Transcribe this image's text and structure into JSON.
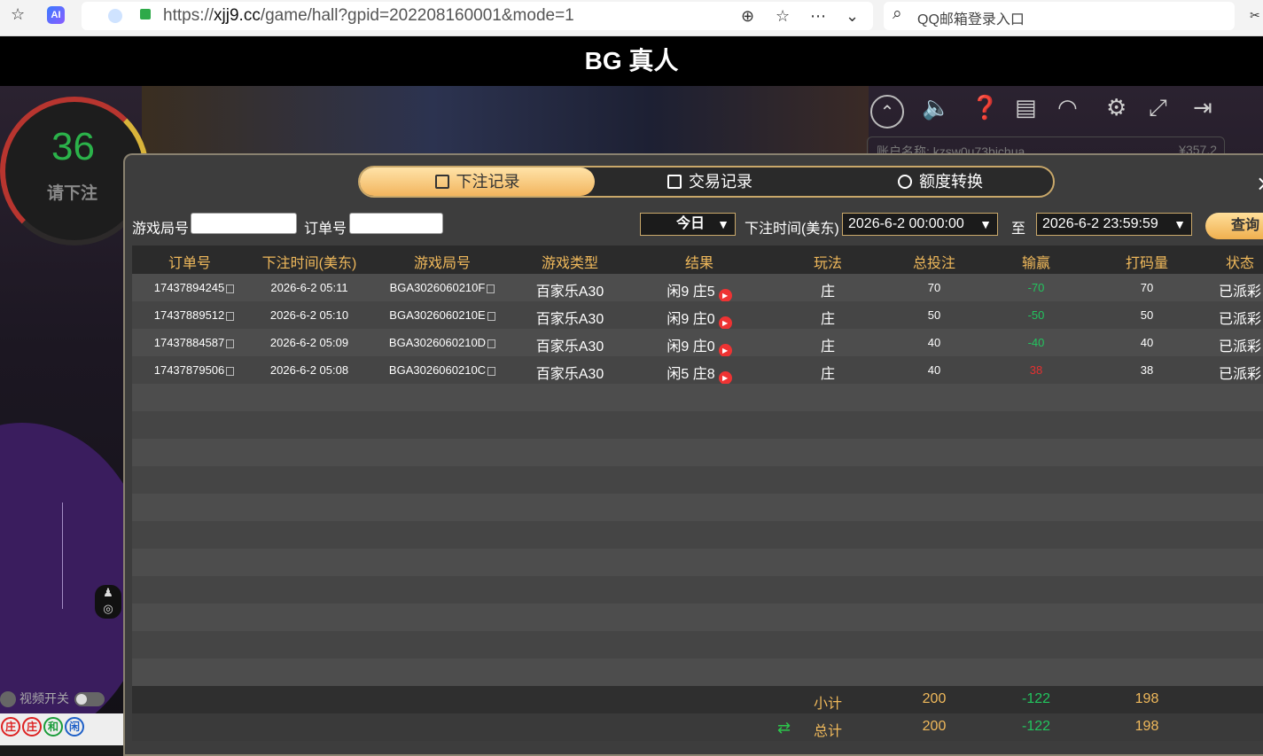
{
  "browser": {
    "url_prefix": "https://",
    "url_host": "xjj9.cc",
    "url_path": "/game/hall?gpid=202208160001&mode=1",
    "search_text": "QQ邮箱登录入口",
    "ai_badge": "AI"
  },
  "page_title": "BG 真人",
  "game": {
    "timer": "36",
    "timer_label": "请下注",
    "video_toggle_label": "视频开关",
    "roadmap": [
      "庄",
      "庄",
      "和",
      "闲"
    ],
    "account_text": "账户名称: kzsw0u73bichua",
    "balance_text": "¥357.2"
  },
  "tabs": [
    {
      "label": "下注记录",
      "active": true
    },
    {
      "label": "交易记录",
      "active": false
    },
    {
      "label": "额度转换",
      "active": false
    }
  ],
  "filters": {
    "game_round_label": "游戏局号",
    "game_round_value": "",
    "order_label": "订单号",
    "order_value": "",
    "period_value": "今日",
    "time_label": "下注时间(美东)",
    "start_time": "2026-6-2 00:00:00",
    "to_label": "至",
    "end_time": "2026-6-2 23:59:59",
    "query_label": "查询"
  },
  "table": {
    "headers": [
      "订单号",
      "下注时间(美东)",
      "游戏局号",
      "游戏类型",
      "结果",
      "玩法",
      "总投注",
      "输赢",
      "打码量",
      "状态"
    ],
    "rows": [
      {
        "order": "17437894245",
        "time": "2026-6-2 05:11",
        "round": "BGA3026060210F",
        "type": "百家乐A30",
        "result": "闲9 庄5",
        "play": "庄",
        "bet": "70",
        "winloss": "-70",
        "valid": "70",
        "status": "已派彩"
      },
      {
        "order": "17437889512",
        "time": "2026-6-2 05:10",
        "round": "BGA3026060210E",
        "type": "百家乐A30",
        "result": "闲9 庄0",
        "play": "庄",
        "bet": "50",
        "winloss": "-50",
        "valid": "50",
        "status": "已派彩"
      },
      {
        "order": "17437884587",
        "time": "2026-6-2 05:09",
        "round": "BGA3026060210D",
        "type": "百家乐A30",
        "result": "闲9 庄0",
        "play": "庄",
        "bet": "40",
        "winloss": "-40",
        "valid": "40",
        "status": "已派彩"
      },
      {
        "order": "17437879506",
        "time": "2026-6-2 05:08",
        "round": "BGA3026060210C",
        "type": "百家乐A30",
        "result": "闲5 庄8",
        "play": "庄",
        "bet": "40",
        "winloss": "38",
        "valid": "38",
        "status": "已派彩"
      }
    ],
    "subtotal": {
      "label": "小计",
      "bet": "200",
      "winloss": "-122",
      "valid": "198"
    },
    "total": {
      "label": "总计",
      "bet": "200",
      "winloss": "-122",
      "valid": "198"
    }
  },
  "colors": {
    "accent_gold": "#f0b95b",
    "win_negative": "#22c55e",
    "win_positive": "#e53030"
  }
}
